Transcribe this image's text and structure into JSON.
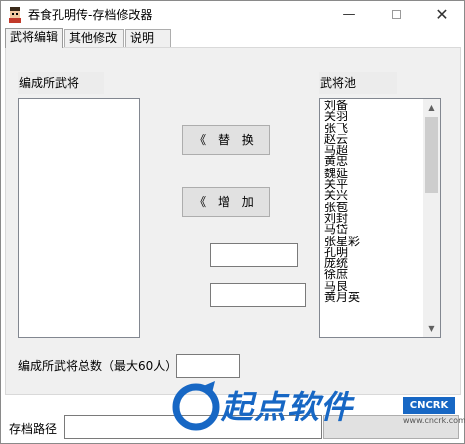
{
  "window": {
    "title": "吞食孔明传-存档修改器",
    "controls": {
      "minimize": "—",
      "close": "✕"
    }
  },
  "tabs": [
    {
      "label": "武将编辑",
      "active": true
    },
    {
      "label": "其他修改",
      "active": false
    },
    {
      "label": "说明",
      "active": false
    }
  ],
  "general_edit": {
    "formation_label": "编成所武将",
    "pool_label": "武将池",
    "replace_button": "《 替 换",
    "add_button": "《 增 加",
    "total_label": "编成所武将总数（最大60人）",
    "field_1_value": "",
    "field_2_value": "",
    "total_value": "",
    "pool_items": [
      "刘备",
      "关羽",
      "张飞",
      "赵云",
      "马超",
      "黄忠",
      "魏延",
      "关平",
      "关兴",
      "张苞",
      "刘封",
      "马岱",
      "张星彩",
      "孔明",
      "庞统",
      "徐庶",
      "马良",
      "黄月英"
    ]
  },
  "footer": {
    "path_label": "存档路径",
    "path_value": ""
  },
  "watermark": {
    "text": "起点软件",
    "badge": "CNCRK",
    "url": "www.cncrk.com"
  },
  "colors": {
    "accent": "#1767c4",
    "panel_bg": "#f0f0f0",
    "button_bg": "#e1e1e1"
  }
}
